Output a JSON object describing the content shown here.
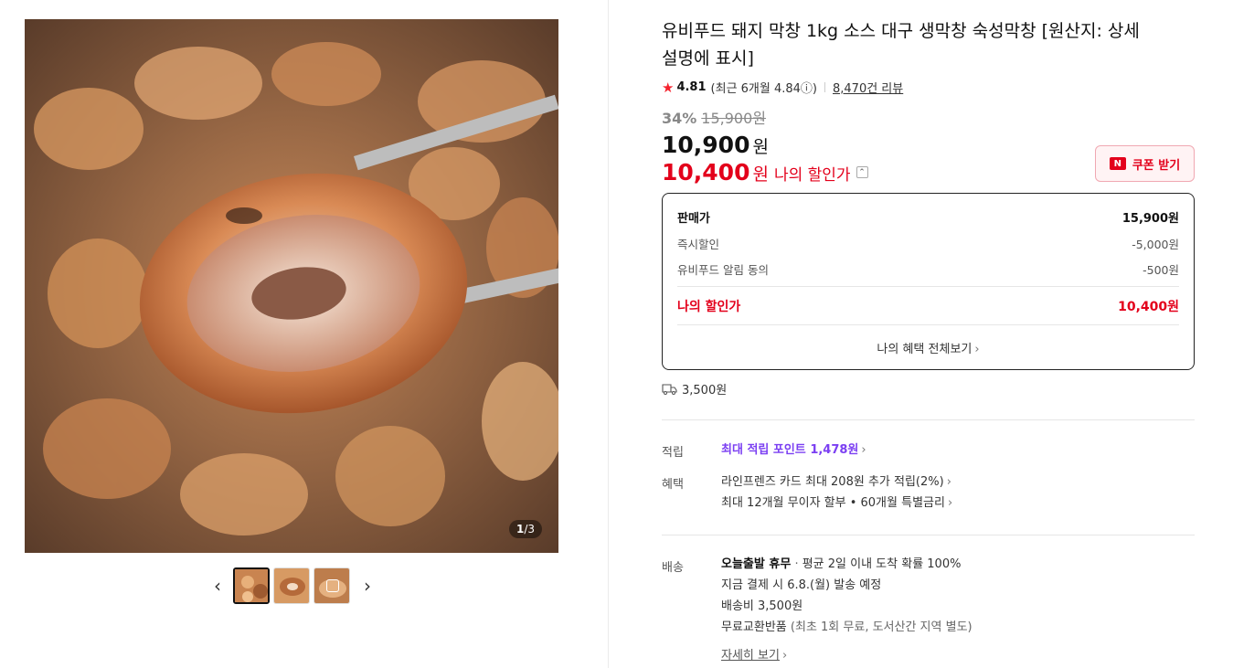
{
  "gallery": {
    "counter_current": "1",
    "counter_total": "/3",
    "prev_icon": "chevron-left-icon",
    "next_icon": "chevron-right-icon"
  },
  "product": {
    "title": "유비푸드 돼지 막창 1kg 소스 대구 생막창 숙성막창 [원산지: 상세설명에 표시]",
    "rating": "4.81",
    "rating_recent": "(최근 6개월 4.84ⓘ)",
    "review_count": "8,470건 리뷰",
    "discount_rate": "34%",
    "original_price": "15,900원",
    "price": "10,900",
    "price_unit": "원",
    "my_price": "10,400",
    "my_price_unit": "원",
    "my_price_label": "나의 할인가",
    "coupon_label": "쿠폰 받기",
    "coupon_logo": "N"
  },
  "price_box": {
    "rows": [
      {
        "label": "판매가",
        "value": "15,900원"
      },
      {
        "label": "즉시할인",
        "value": "-5,000원"
      },
      {
        "label": "유비푸드 알림 동의",
        "value": "-500원"
      }
    ],
    "my_label": "나의 할인가",
    "my_value": "10,400원",
    "more_label": "나의 혜택 전체보기"
  },
  "delivery_fee": "3,500원",
  "benefits": {
    "points_label": "적립",
    "points_text": "최대 적립 포인트",
    "points_value": "1,478원",
    "benefit_label": "혜택",
    "benefit_line1": "라인프렌즈 카드 최대 208원 추가 적립(2%)",
    "benefit_line2": "최대 12개월 무이자 할부 • 60개월 특별금리"
  },
  "shipping": {
    "label": "배송",
    "today_title": "오늘출발 휴무",
    "today_desc": "평균 2일 이내 도착 확률 100%",
    "line2": "지금 결제 시 6.8.(월) 발송 예정",
    "line3": "배송비 3,500원",
    "line4_bold": "무료교환반품",
    "line4_rest": "(최초 1회 무료, 도서산간 지역 별도)",
    "detail_link": "자세히 보기"
  },
  "colors": {
    "accent_red": "#e3001b",
    "point_purple": "#7b3ff2"
  }
}
